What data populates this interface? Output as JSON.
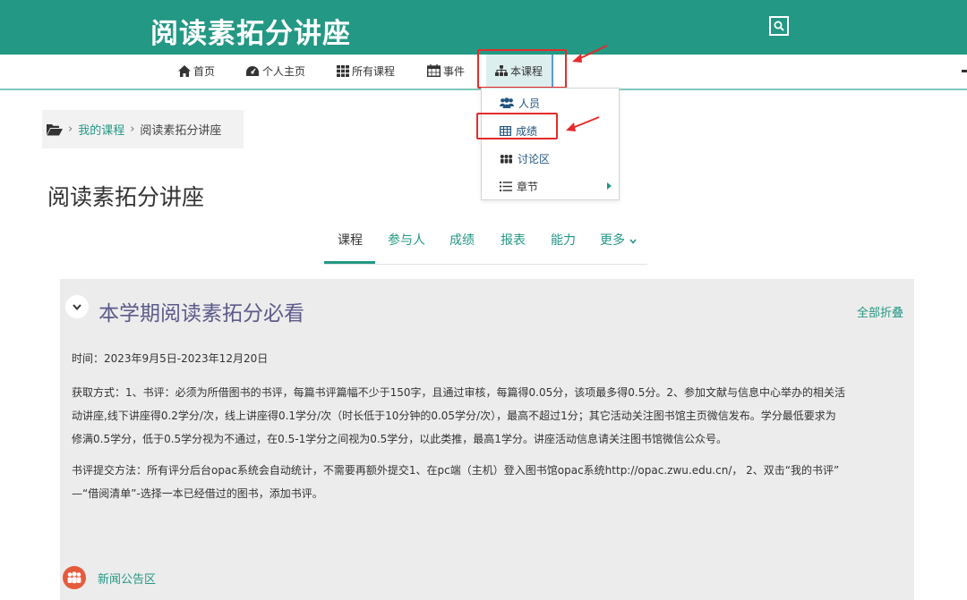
{
  "header": {
    "site_title": "阅读素拓分讲座"
  },
  "nav": {
    "items": [
      {
        "label": "首页",
        "icon": "home-icon"
      },
      {
        "label": "个人主页",
        "icon": "dashboard-icon"
      },
      {
        "label": "所有课程",
        "icon": "grid-icon"
      },
      {
        "label": "事件",
        "icon": "calendar-icon"
      },
      {
        "label": "本课程",
        "icon": "sitemap-icon"
      }
    ]
  },
  "dropdown": {
    "items": [
      {
        "label": "人员",
        "icon": "users-icon"
      },
      {
        "label": "成绩",
        "icon": "table-icon"
      },
      {
        "label": "讨论区",
        "icon": "group-icon"
      },
      {
        "label": "章节",
        "icon": "list-icon"
      }
    ]
  },
  "breadcrumb": {
    "items": [
      "我的课程",
      "阅读素拓分讲座"
    ]
  },
  "page_title": "阅读素拓分讲座",
  "tabs": [
    {
      "label": "课程"
    },
    {
      "label": "参与人"
    },
    {
      "label": "成绩"
    },
    {
      "label": "报表"
    },
    {
      "label": "能力"
    },
    {
      "label": "更多"
    }
  ],
  "section": {
    "title": "本学期阅读素拓分必看",
    "collapse_all": "全部折叠",
    "time": "时间：2023年9月5日-2023年12月20日",
    "method_lines": [
      "获取方式：1、书评：必须为所借图书的书评，每篇书评篇幅不少于150字，且通过审核，每篇得0.05分，该项最多得0.5分。2、参加文献与信息中心举办的相关活",
      "动讲座,线下讲座得0.2学分/次，线上讲座得0.1学分/次（时长低于10分钟的0.05学分/次），最高不超过1分；其它活动关注图书馆主页微信发布。学分最低要求为",
      "修满0.5学分，低于0.5学分视为不通过，在0.5-1学分之间视为0.5学分，以此类推，最高1学分。讲座活动信息请关注图书馆微信公众号。"
    ],
    "submit_lines": [
      "书评提交方法：所有评分后台opac系统会自动统计，不需要再额外提交1、在pc端（主机）登入图书馆opac系统http://opac.zwu.edu.cn/，  2、双击“我的书评”",
      "—“借阅清单”-选择一本已经借过的图书，添加书评。"
    ]
  },
  "news": {
    "label": "新闻公告区"
  },
  "colors": {
    "brand": "#239884",
    "highlight": "#e52b2b",
    "section_bg": "#ececec"
  }
}
